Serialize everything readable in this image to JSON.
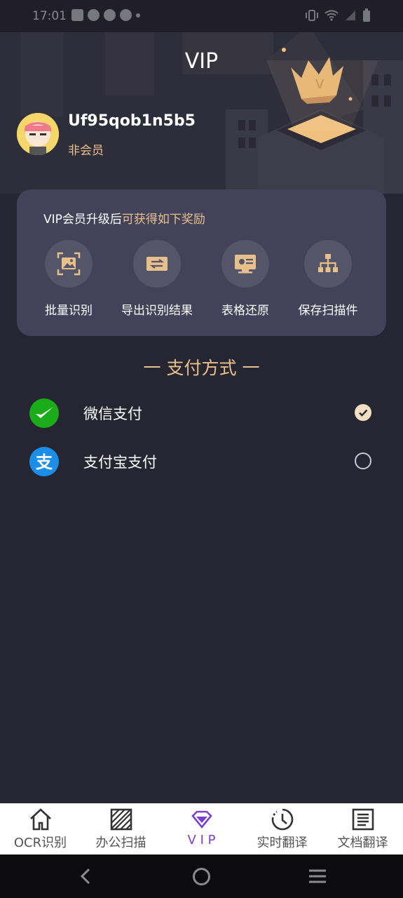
{
  "status_bar": {
    "time": "17:01"
  },
  "header": {
    "title": "VIP"
  },
  "user": {
    "name": "Uf95qob1n5b5",
    "status": "非会员"
  },
  "benefits_card": {
    "title_prefix": "VIP会员升级后",
    "title_highlight": "可获得如下奖励",
    "items": [
      {
        "label": "批量识别",
        "icon": "image-scan-icon"
      },
      {
        "label": "导出识别结果",
        "icon": "export-icon"
      },
      {
        "label": "表格还原",
        "icon": "table-icon"
      },
      {
        "label": "保存扫描件",
        "icon": "hierarchy-icon"
      }
    ]
  },
  "payment": {
    "title": "一 支付方式 一",
    "options": [
      {
        "label": "微信支付",
        "selected": true,
        "icon": "wechat-pay-icon"
      },
      {
        "label": "支付宝支付",
        "selected": false,
        "icon": "alipay-icon"
      }
    ]
  },
  "bottom_nav": {
    "items": [
      {
        "label": "OCR识别",
        "icon": "home-icon",
        "active": false
      },
      {
        "label": "办公扫描",
        "icon": "scan-icon",
        "active": false
      },
      {
        "label": "V I P",
        "icon": "diamond-icon",
        "active": true
      },
      {
        "label": "实时翻译",
        "icon": "clock-icon",
        "active": false
      },
      {
        "label": "文档翻译",
        "icon": "document-icon",
        "active": false
      }
    ]
  },
  "colors": {
    "accent_gold": "#e8c08c",
    "active_purple": "#7a3fd0",
    "wechat_green": "#1aad19",
    "alipay_blue": "#1b8ee8"
  }
}
